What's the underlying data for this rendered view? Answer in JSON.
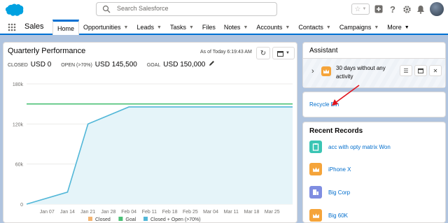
{
  "header": {
    "search_placeholder": "Search Salesforce",
    "brand_color": "#00a1e0"
  },
  "nav": {
    "app_name": "Sales",
    "items": [
      {
        "label": "Home",
        "active": true,
        "has_menu": false
      },
      {
        "label": "Opportunities",
        "has_menu": true
      },
      {
        "label": "Leads",
        "has_menu": true
      },
      {
        "label": "Tasks",
        "has_menu": true
      },
      {
        "label": "Files",
        "has_menu": false
      },
      {
        "label": "Notes",
        "has_menu": true
      },
      {
        "label": "Accounts",
        "has_menu": true
      },
      {
        "label": "Contacts",
        "has_menu": true
      },
      {
        "label": "Campaigns",
        "has_menu": true
      },
      {
        "label": "More",
        "has_menu": true
      }
    ]
  },
  "performance": {
    "title": "Quarterly Performance",
    "as_of": "As of Today 6:19:43 AM",
    "closed_label": "CLOSED",
    "closed_value": "USD 0",
    "open_label": "OPEN (>70%)",
    "open_value": "USD 145,500",
    "goal_label": "GOAL",
    "goal_value": "USD 150,000"
  },
  "chart_data": {
    "type": "line",
    "x": [
      "Jan 07",
      "Jan 14",
      "Jan 21",
      "Jan 28",
      "Feb 04",
      "Feb 11",
      "Feb 18",
      "Feb 25",
      "Mar 04",
      "Mar 11",
      "Mar 18",
      "Mar 25"
    ],
    "yticks": [
      "0",
      "60k",
      "120k",
      "180k"
    ],
    "ylim": [
      0,
      180000
    ],
    "series": [
      {
        "name": "Closed",
        "color": "#f4b470",
        "points": []
      },
      {
        "name": "Goal",
        "color": "#4bc076",
        "points": [
          [
            0,
            150000
          ],
          [
            13,
            150000
          ]
        ]
      },
      {
        "name": "Closed + Open (>70%)",
        "color": "#52b7d8",
        "points": [
          [
            0,
            0
          ],
          [
            2,
            18000
          ],
          [
            3,
            120000
          ],
          [
            5,
            145500
          ],
          [
            13,
            145500
          ]
        ]
      }
    ],
    "legend_position": "bottom",
    "grid": true
  },
  "assistant": {
    "title": "Assistant",
    "message": "30 days without any activity"
  },
  "recycle": {
    "link": "Recycle Bin",
    "arrow_color": "#e0121b"
  },
  "recent": {
    "title": "Recent Records",
    "items": [
      {
        "label": "acc with opty matrix Won",
        "icon": "account-icon",
        "color": "#3bc5b4"
      },
      {
        "label": "iPhone X",
        "icon": "crown-icon",
        "color": "#f5a43a"
      },
      {
        "label": "Big Corp",
        "icon": "building-icon",
        "color": "#7f8de1"
      },
      {
        "label": "Big 60K",
        "icon": "crown-icon",
        "color": "#f5a43a"
      }
    ]
  }
}
